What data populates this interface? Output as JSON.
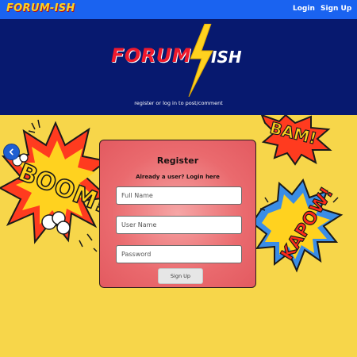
{
  "nav": {
    "brand": "FORUM-ISH",
    "login_label": "Login",
    "signup_label": "Sign Up"
  },
  "hero": {
    "logo_part1": "FORUM",
    "logo_part2": "ISH",
    "tagline": "register or log in to post/comment"
  },
  "art": {
    "left_burst": "BOOM!",
    "top_right_burst": "BAM!",
    "right_burst": "KAPOW!"
  },
  "back_button": {
    "icon": "chevron-left-icon"
  },
  "register": {
    "title": "Register",
    "subtitle": "Already a user? Login here",
    "full_name_placeholder": "Full Name",
    "user_name_placeholder": "User Name",
    "password_placeholder": "Password",
    "submit_label": "Sign Up"
  },
  "colors": {
    "nav_bg": "#1a63f0",
    "hero_bg": "#07196f",
    "page_bg": "#f7d64a",
    "card_bg": "#ea6a6e",
    "brand_yellow": "#ffd21f",
    "logo_red": "#ef1a2d"
  }
}
